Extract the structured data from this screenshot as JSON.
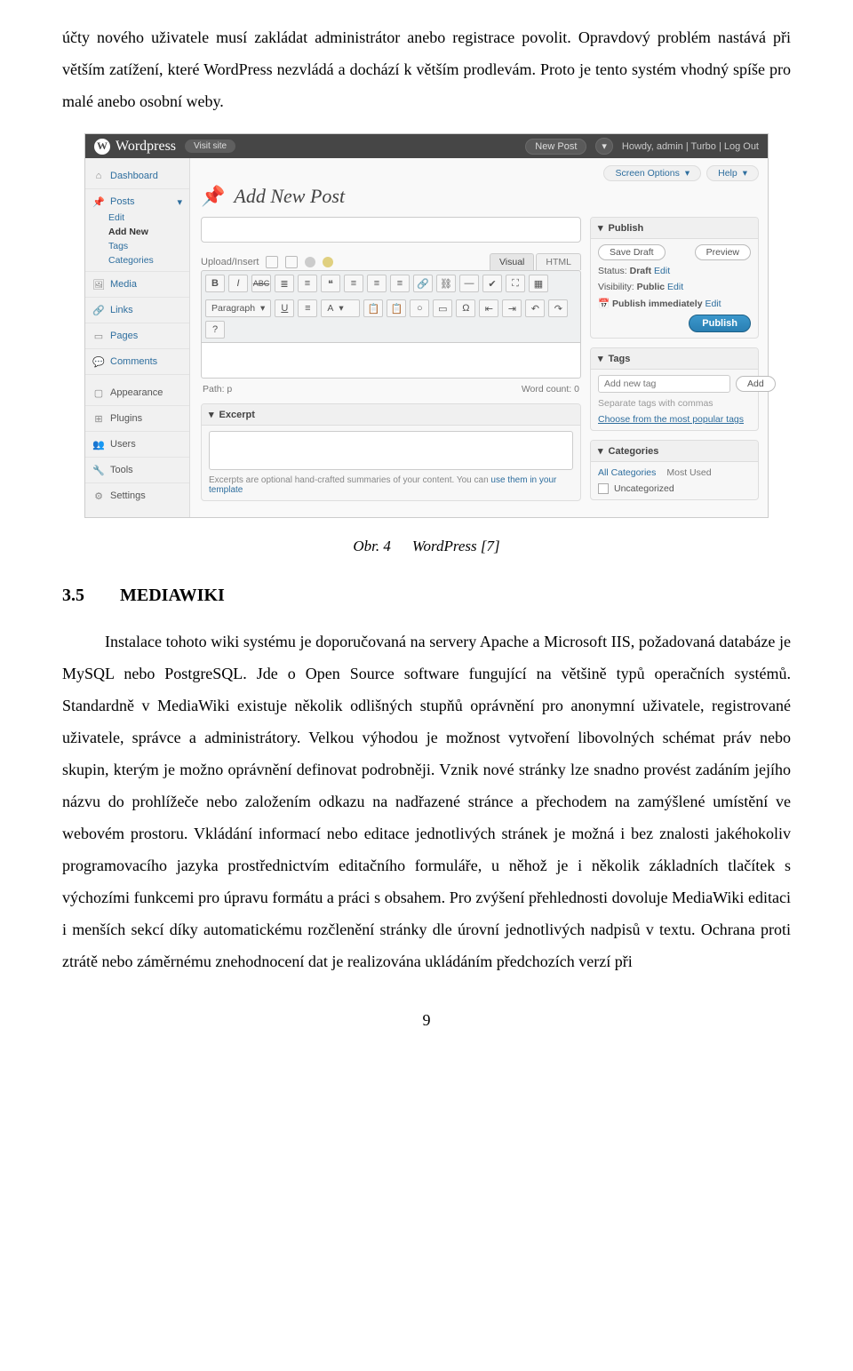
{
  "doc": {
    "para_top": "účty nového uživatele musí zakládat administrátor anebo registrace povolit. Opravdový problém nastává při větším zatížení, které WordPress nezvládá a dochází k větším prodlevám. Proto je tento systém vhodný spíše pro malé anebo osobní weby.",
    "caption_prefix": "Obr. 4",
    "caption_text": "WordPress [7]",
    "section_num": "3.5",
    "section_title": "MEDIAWIKI",
    "para_body": "Instalace tohoto wiki systému je doporučovaná na servery Apache a Microsoft IIS, požadovaná databáze je MySQL nebo PostgreSQL. Jde o Open Source software fungující na většině typů operačních systémů. Standardně v MediaWiki existuje několik odlišných stupňů oprávnění pro anonymní uživatele, registrované uživatele, správce a administrátory. Velkou výhodou je možnost vytvoření libovolných schémat práv nebo skupin, kterým je možno oprávnění definovat podrobněji. Vznik nové stránky lze snadno provést zadáním jejího názvu do prohlížeče nebo založením odkazu na nadřazené stránce a přechodem na zamýšlené umístění ve webovém prostoru. Vkládání informací nebo editace jednotlivých stránek je možná i bez znalosti jakéhokoliv programovacího jazyka prostřednictvím editačního formuláře, u něhož je i několik základních tlačítek s výchozími funkcemi pro úpravu formátu a práci s obsahem. Pro zvýšení přehlednosti dovoluje MediaWiki editaci i menších sekcí díky automatickému rozčlenění stránky dle úrovní jednotlivých nadpisů v textu. Ochrana proti ztrátě nebo záměrnému znehodnocení dat je realizována ukládáním předchozích verzí při",
    "page_number": "9"
  },
  "wp": {
    "brand": "Wordpress",
    "visit_site": "Visit site",
    "top_new_post": "New Post",
    "arrow": "▾",
    "howdy": "Howdy, admin | Turbo | Log Out",
    "screen_options": "Screen Options",
    "help": "Help",
    "page_title": "Add New Post",
    "sidebar": {
      "dashboard": "Dashboard",
      "posts": "Posts",
      "edit": "Edit",
      "add_new": "Add New",
      "tags": "Tags",
      "categories": "Categories",
      "media": "Media",
      "links": "Links",
      "pages": "Pages",
      "comments": "Comments",
      "appearance": "Appearance",
      "plugins": "Plugins",
      "users": "Users",
      "tools": "Tools",
      "settings": "Settings"
    },
    "editor": {
      "upload_label": "Upload/Insert",
      "visual": "Visual",
      "html": "HTML",
      "paragraph": "Paragraph",
      "path_label": "Path: p",
      "wordcount": "Word count: 0",
      "excerpt_title": "Excerpt",
      "excerpt_note_a": "Excerpts are optional hand-crafted summaries of your content. You can ",
      "excerpt_note_link": "use them in your template",
      "tb": {
        "b": "B",
        "i": "I",
        "abc": "ABC",
        "u": "U",
        "a": "A"
      }
    },
    "panels": {
      "publish": {
        "title": "Publish",
        "save_draft": "Save Draft",
        "preview": "Preview",
        "status_label": "Status:",
        "status_value": "Draft",
        "edit": "Edit",
        "visibility_label": "Visibility:",
        "visibility_value": "Public",
        "publish_mode": "Publish immediately",
        "publish_btn": "Publish"
      },
      "tags": {
        "title": "Tags",
        "placeholder": "Add new tag",
        "add": "Add",
        "separate": "Separate tags with commas",
        "choose": "Choose from the most popular tags"
      },
      "categories": {
        "title": "Categories",
        "all": "All Categories",
        "most_used": "Most Used",
        "uncategorized": "Uncategorized"
      }
    }
  }
}
